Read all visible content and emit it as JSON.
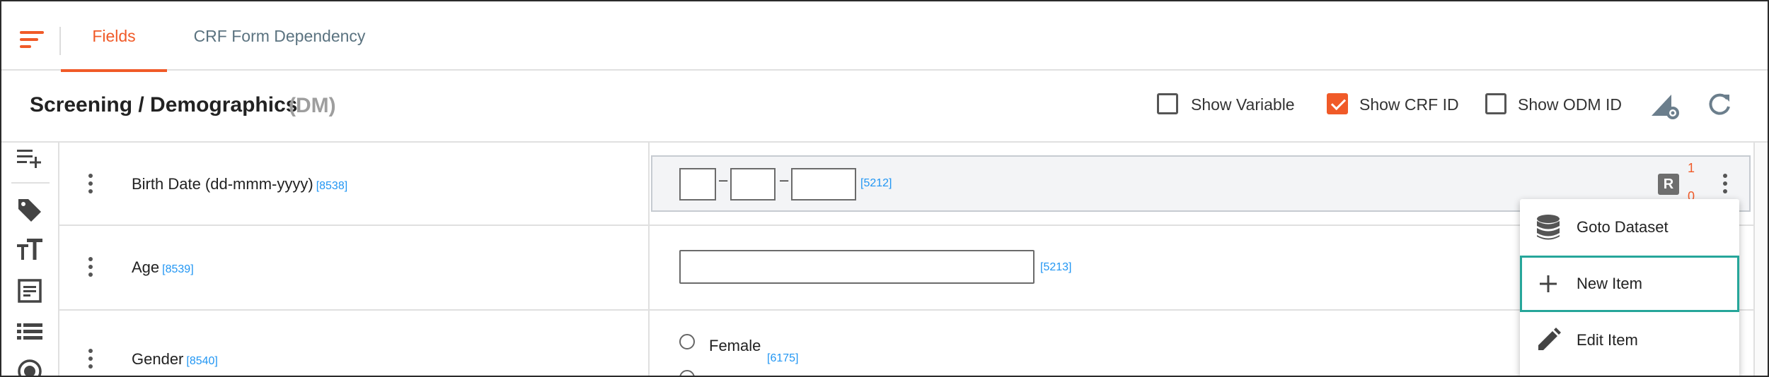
{
  "tabs": [
    {
      "label": "Fields",
      "active": true
    },
    {
      "label": "CRF Form Dependency",
      "active": false
    }
  ],
  "form": {
    "title": "Screening / Demographics",
    "code": "(DM)"
  },
  "toggles": [
    {
      "label": "Show Variable",
      "checked": false
    },
    {
      "label": "Show CRF ID",
      "checked": true
    },
    {
      "label": "Show ODM ID",
      "checked": false
    }
  ],
  "rows": [
    {
      "label": "Birth Date (dd-mmm-yyyy)",
      "id": "[8538]",
      "field_id": "[5212]",
      "date_separator": "–"
    },
    {
      "label": "Age",
      "id": "[8539]",
      "field_id": "[5213]"
    },
    {
      "label": "Gender",
      "id": "[8540]",
      "field_id": "[6175]",
      "options": [
        "Female"
      ]
    }
  ],
  "selected_row": {
    "badge": "R",
    "count_top": "1",
    "count_bottom": "0"
  },
  "context_menu": {
    "items": [
      {
        "label": "Goto Dataset",
        "icon": "database-icon",
        "highlighted": false
      },
      {
        "label": "New Item",
        "icon": "plus-icon",
        "highlighted": true
      },
      {
        "label": "Edit Item",
        "icon": "pencil-icon",
        "highlighted": false
      }
    ]
  },
  "colors": {
    "accent": "#f05a28",
    "link": "#2196f3",
    "highlight": "#26a69a"
  }
}
